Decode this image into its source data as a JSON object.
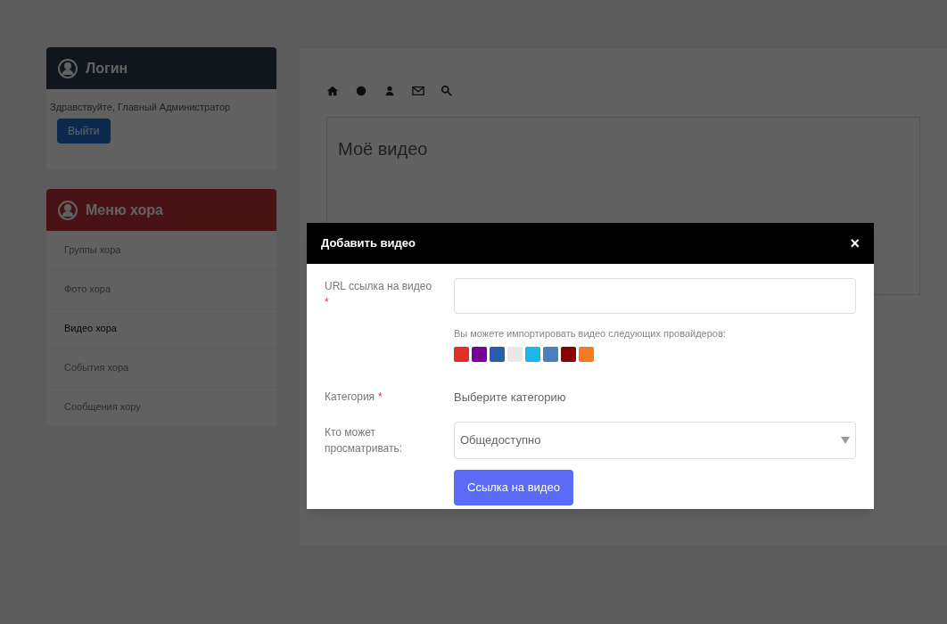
{
  "login_panel": {
    "title": "Логин",
    "greeting": "Здравствуйте, Главный Администратор",
    "logout_button": "Выйти"
  },
  "choir_menu": {
    "title": "Меню хора",
    "items": [
      {
        "label": "Группы хора",
        "selected": false
      },
      {
        "label": "Фото хора",
        "selected": false
      },
      {
        "label": "Видео хора",
        "selected": true
      },
      {
        "label": "События хора",
        "selected": false
      },
      {
        "label": "Сообщения хору",
        "selected": false
      }
    ]
  },
  "main": {
    "page_title": "Моё видео"
  },
  "modal": {
    "title": "Добавить видео",
    "close": "×",
    "url_label": "URL ссылка на видео",
    "required_mark": "*",
    "providers_hint": "Вы можете импортировать видео следующих провайдеров:",
    "providers": [
      {
        "color": "#e52d27"
      },
      {
        "color": "#7b0099"
      },
      {
        "color": "#2a5db0"
      },
      {
        "color": "#e8e8e8"
      },
      {
        "color": "#1ab7ea"
      },
      {
        "color": "#4a7fc0"
      },
      {
        "color": "#8b0000"
      },
      {
        "color": "#f47b20"
      }
    ],
    "category_label": "Категория",
    "category_required_mark": "*",
    "category_value": "Выберите категорию",
    "visibility_label": "Кто может просматривать:",
    "visibility_value": "Общедоступно",
    "submit_button": "Ссылка на видео"
  }
}
